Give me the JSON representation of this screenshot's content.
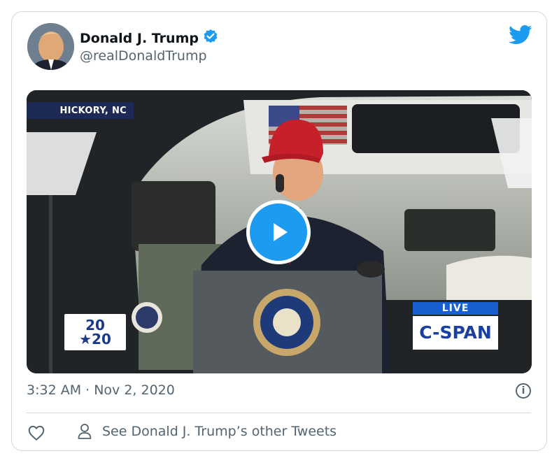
{
  "tweet": {
    "author_name": "Donald J. Trump",
    "handle": "@realDonaldTrump",
    "verified": true,
    "timestamp": "3:32 AM · Nov 2, 2020",
    "other_tweets_label": "See Donald J. Trump’s other Tweets"
  },
  "video": {
    "location_label": "HICKORY, NC",
    "live_label": "LIVE",
    "network_label": "C-SPAN",
    "logo_text_top": "20",
    "logo_text_bottom": "★20"
  },
  "colors": {
    "accent": "#1d9bf0",
    "secondary_text": "#536471",
    "border": "#cfd9de"
  },
  "icons": [
    "verified-badge-icon",
    "twitter-bird-icon",
    "play-icon",
    "info-icon",
    "heart-icon",
    "person-icon"
  ]
}
